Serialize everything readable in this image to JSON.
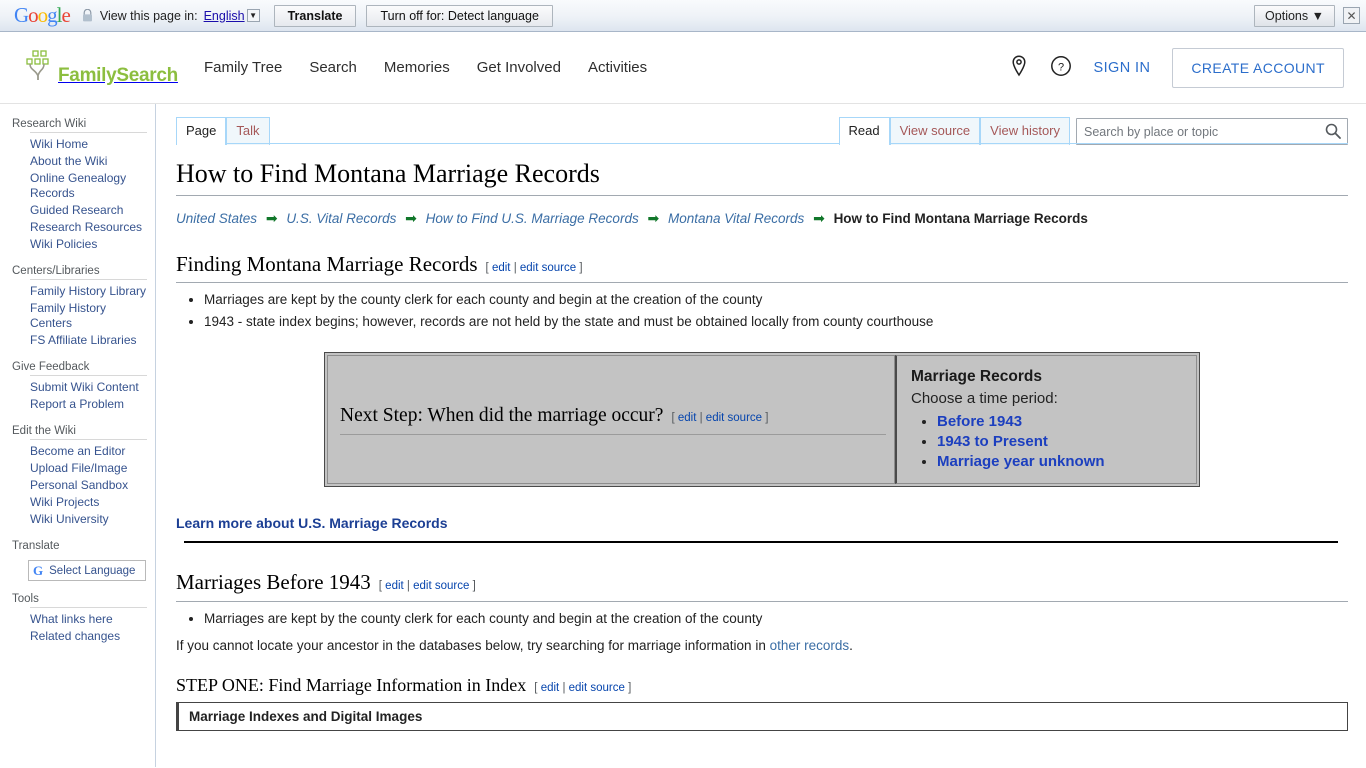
{
  "translate_bar": {
    "logo": "Google",
    "lock_icon": "lock-icon",
    "view_text": "View this page in:",
    "language": "English",
    "translate_button": "Translate",
    "turnoff_button": "Turn off for: Detect language",
    "options_button": "Options",
    "close_icon": "close-icon"
  },
  "header": {
    "brand": "FamilySearch",
    "nav": [
      {
        "label": "Family Tree"
      },
      {
        "label": "Search"
      },
      {
        "label": "Memories"
      },
      {
        "label": "Get Involved"
      },
      {
        "label": "Activities"
      }
    ],
    "location_icon": "map-pin-icon",
    "help_icon": "help-circle-icon",
    "signin": "SIGN IN",
    "create_account": "CREATE ACCOUNT"
  },
  "sidebar": {
    "groups": [
      {
        "title": "Research Wiki",
        "items": [
          "Wiki Home",
          "About the Wiki",
          "Online Genealogy Records",
          "Guided Research",
          "Research Resources",
          "Wiki Policies"
        ]
      },
      {
        "title": "Centers/Libraries",
        "items": [
          "Family History Library",
          "Family History Centers",
          "FS Affiliate Libraries"
        ]
      },
      {
        "title": "Give Feedback",
        "items": [
          "Submit Wiki Content",
          "Report a Problem"
        ]
      },
      {
        "title": "Edit the Wiki",
        "items": [
          "Become an Editor",
          "Upload File/Image",
          "Personal Sandbox",
          "Wiki Projects",
          "Wiki University"
        ]
      }
    ],
    "translate_title": "Translate",
    "select_language": "Select Language",
    "tools_title": "Tools",
    "tools_items": [
      "What links here",
      "Related changes"
    ]
  },
  "tabs": {
    "left": [
      {
        "label": "Page",
        "selected": true
      },
      {
        "label": "Talk",
        "selected": false
      }
    ],
    "right": [
      {
        "label": "Read",
        "selected": true
      },
      {
        "label": "View source",
        "selected": false
      },
      {
        "label": "View history",
        "selected": false
      }
    ]
  },
  "search": {
    "placeholder": "Search by place or topic",
    "value": "",
    "icon": "search-icon"
  },
  "main": {
    "title": "How to Find Montana Marriage Records",
    "breadcrumb": {
      "links": [
        "United States",
        "U.S. Vital Records",
        "How to Find U.S. Marriage Records",
        "Montana Vital Records"
      ],
      "current": "How to Find Montana Marriage Records",
      "separator": "➡"
    },
    "edit_label": "edit",
    "edit_source_label": "edit source",
    "bracket_open": "[",
    "bracket_close": "]",
    "pipe": "|",
    "section1": {
      "heading": "Finding Montana Marriage Records",
      "bullets": [
        "Marriages are kept by the county clerk for each county and begin at the creation of the county",
        "1943 - state index begins; however, records are not held by the state and must be obtained locally from county courthouse"
      ]
    },
    "decision_box": {
      "question": "Next Step: When did the marriage occur?",
      "panel_title": "Marriage Records",
      "panel_subtitle": "Choose a time period:",
      "options": [
        "Before 1943",
        "1943 to Present",
        "Marriage year unknown"
      ]
    },
    "learn_more": "Learn more about U.S. Marriage Records",
    "section2": {
      "heading": "Marriages Before 1943",
      "bullets": [
        "Marriages are kept by the county clerk for each county and begin at the creation of the county"
      ],
      "paragraph_before": "If you cannot locate your ancestor in the databases below, try searching for marriage information in ",
      "paragraph_link": "other records",
      "paragraph_after": "."
    },
    "section3": {
      "heading": "STEP ONE: Find Marriage Information in Index",
      "infobox": "Marriage Indexes and Digital Images"
    }
  }
}
